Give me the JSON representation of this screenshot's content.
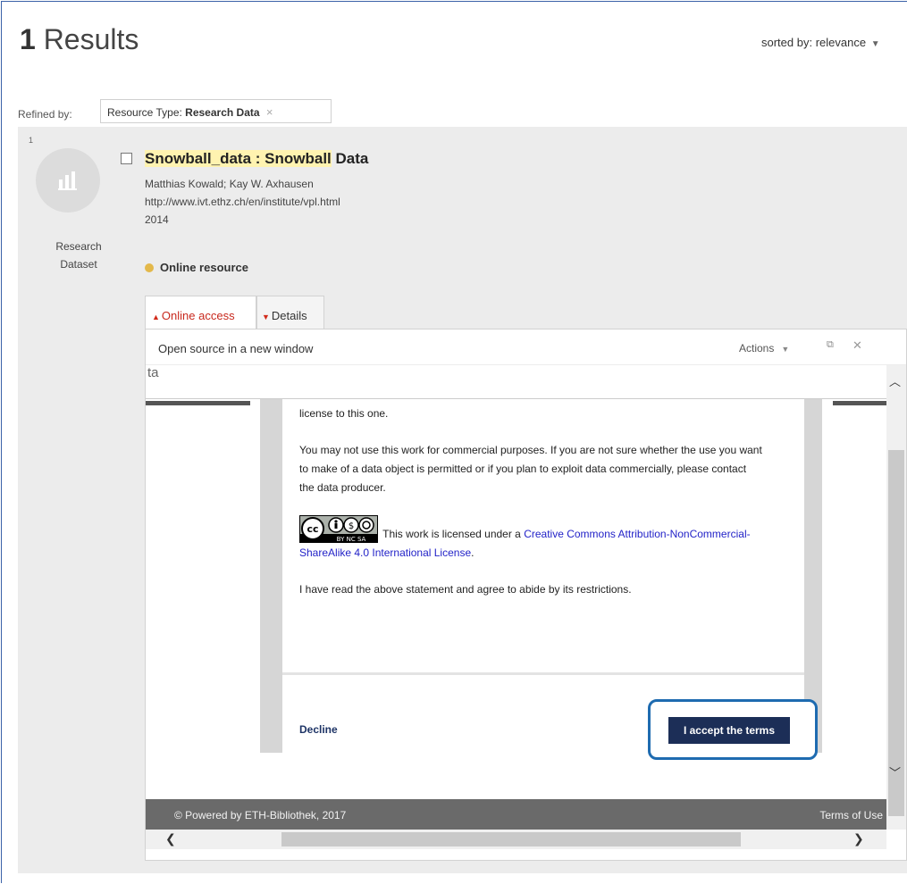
{
  "header": {
    "results_count": "1",
    "results_label": "Results",
    "sorted_label": "sorted by: relevance"
  },
  "refine": {
    "label": "Refined by:",
    "facet_prefix": "Resource Type:",
    "facet_value": "Research Data",
    "remove": "×"
  },
  "record": {
    "number": "1",
    "type_icon": "bar-chart-icon",
    "type_label_1": "Research",
    "type_label_2": "Dataset",
    "title_part1": "Snowball",
    "title_part2": "_data : ",
    "title_part3": "Snowball",
    "title_part4": " Data",
    "authors": "Matthias Kowald; Kay W. Axhausen",
    "url": "http://www.ivt.ethz.ch/en/institute/vpl.html",
    "year": "2014",
    "availability": "Online resource",
    "availability_color": "#e3b84a"
  },
  "tabs": {
    "online_access": "Online access",
    "details": "Details"
  },
  "panel": {
    "open_source": "Open source in a new window",
    "actions": "Actions",
    "cut_text": "ta"
  },
  "license": {
    "p1": "license to this one.",
    "p2": "You may not use this work for commercial purposes. If you are not sure whether the use you want to make of a data object is permitted or if you plan to exploit data commercially, please contact the data producer.",
    "cc_intro": " This work is licensed under a ",
    "cc_link": "Creative Commons Attribution-NonCommercial-ShareAlike 4.0 International License",
    "cc_end": ".",
    "p4": "I have read the above statement and agree to abide by its restrictions.",
    "badge_text": "BY NC SA"
  },
  "buttons": {
    "decline": "Decline",
    "accept": "I accept the terms"
  },
  "footer": {
    "copyright": "© Powered by ETH-Bibliothek, 2017",
    "terms": "Terms of Use"
  },
  "colors": {
    "accent": "#1c2e57",
    "highlight": "#fff3b0",
    "tab_active": "#c8281d",
    "link": "#2323c8",
    "focus_ring": "#1e6bb0"
  }
}
